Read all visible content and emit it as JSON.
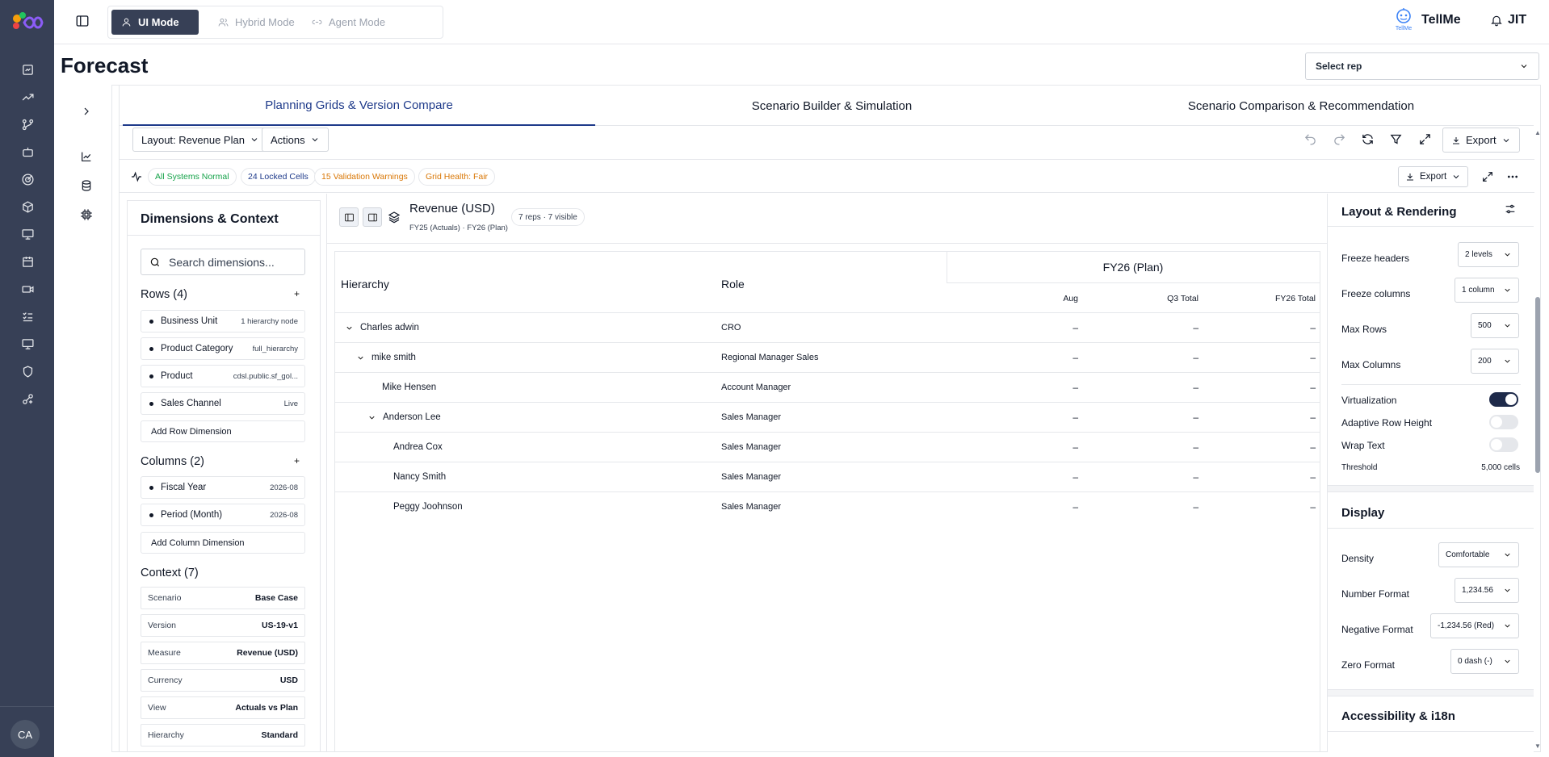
{
  "app": {
    "nav_icons": [
      "dashboard-icon",
      "trend-icon",
      "branch-icon",
      "bot-icon",
      "target-icon",
      "cube-icon",
      "monitor-icon",
      "calendar-icon",
      "video-icon",
      "checklist-icon",
      "display-icon",
      "shield-icon",
      "sparkle-icon"
    ],
    "avatar_initials": "CA",
    "brand_color": "#374056"
  },
  "topbar": {
    "modes": [
      {
        "label": "UI Mode",
        "icon": "user-icon",
        "active": true
      },
      {
        "label": "Hybrid Mode",
        "icon": "users-icon",
        "active": false
      },
      {
        "label": "Agent Mode",
        "icon": "link-icon",
        "active": false
      }
    ],
    "tellme_logo_text": "TellMe",
    "tellme_label": "TellMe",
    "jit_label": "JIT"
  },
  "page": {
    "title": "Forecast",
    "select_rep": "Select rep"
  },
  "tabs": [
    {
      "label": "Planning Grids & Version Compare",
      "active": true
    },
    {
      "label": "Scenario Builder & Simulation",
      "active": false
    },
    {
      "label": "Scenario Comparison & Recommendation",
      "active": false
    }
  ],
  "toolbar": {
    "layout_label": "Layout: Revenue Plan",
    "actions_label": "Actions",
    "export_label": "Export"
  },
  "status": {
    "pills": [
      {
        "label": "All Systems Normal",
        "color": "#16a34a"
      },
      {
        "label": "24 Locked Cells",
        "color": "#1e3a8a"
      },
      {
        "label": "15 Validation Warnings",
        "color": "#d97706"
      },
      {
        "label": "Grid Health: Fair",
        "color": "#d97706"
      }
    ],
    "export_label": "Export"
  },
  "dimensions": {
    "title": "Dimensions & Context",
    "search_placeholder": "Search dimensions...",
    "rows_title": "Rows (4)",
    "rows": [
      {
        "name": "Business Unit",
        "meta": "1 hierarchy node"
      },
      {
        "name": "Product Category",
        "meta": "full_hierarchy"
      },
      {
        "name": "Product",
        "meta": "cdsl.public.sf_gol..."
      },
      {
        "name": "Sales Channel",
        "meta": "Live"
      }
    ],
    "add_row_label": "Add Row Dimension",
    "columns_title": "Columns (2)",
    "columns": [
      {
        "name": "Fiscal Year",
        "meta": "2026-08"
      },
      {
        "name": "Period (Month)",
        "meta": "2026-08"
      }
    ],
    "add_column_label": "Add Column Dimension",
    "context_title": "Context (7)",
    "context": [
      {
        "key": "Scenario",
        "value": "Base Case"
      },
      {
        "key": "Version",
        "value": "US-19-v1"
      },
      {
        "key": "Measure",
        "value": "Revenue (USD)"
      },
      {
        "key": "Currency",
        "value": "USD"
      },
      {
        "key": "View",
        "value": "Actuals vs Plan"
      },
      {
        "key": "Hierarchy",
        "value": "Standard"
      }
    ]
  },
  "grid": {
    "title": "Revenue (USD)",
    "subtitle": "FY25 (Actuals) · FY26 (Plan)",
    "badge": "7 reps · 7 visible",
    "col_hierarchy": "Hierarchy",
    "col_role": "Role",
    "group_header": "FY26 (Plan)",
    "sub_columns": [
      "Aug",
      "Q3 Total",
      "FY26 Total"
    ],
    "rows": [
      {
        "name": "Charles adwin",
        "role": "CRO",
        "level": 0,
        "expandable": true,
        "values": [
          "–",
          "–",
          "–"
        ]
      },
      {
        "name": "mike smith",
        "role": "Regional Manager Sales",
        "level": 1,
        "expandable": true,
        "values": [
          "–",
          "–",
          "–"
        ]
      },
      {
        "name": "Mike Hensen",
        "role": "Account Manager",
        "level": 2,
        "expandable": false,
        "values": [
          "–",
          "–",
          "–"
        ]
      },
      {
        "name": "Anderson Lee",
        "role": "Sales Manager",
        "level": 2,
        "expandable": true,
        "values": [
          "–",
          "–",
          "–"
        ]
      },
      {
        "name": "Andrea Cox",
        "role": "Sales Manager",
        "level": 3,
        "expandable": false,
        "values": [
          "–",
          "–",
          "–"
        ]
      },
      {
        "name": "Nancy Smith",
        "role": "Sales Manager",
        "level": 3,
        "expandable": false,
        "values": [
          "–",
          "–",
          "–"
        ]
      },
      {
        "name": "Peggy Joohnson",
        "role": "Sales Manager",
        "level": 3,
        "expandable": false,
        "values": [
          "–",
          "–",
          "–"
        ]
      }
    ]
  },
  "layout_panel": {
    "title": "Layout & Rendering",
    "freeze_headers_label": "Freeze headers",
    "freeze_headers_value": "2 levels",
    "freeze_columns_label": "Freeze columns",
    "freeze_columns_value": "1 column",
    "max_rows_label": "Max Rows",
    "max_rows_value": "500",
    "max_columns_label": "Max Columns",
    "max_columns_value": "200",
    "virtualization_label": "Virtualization",
    "virtualization_on": true,
    "adaptive_label": "Adaptive Row Height",
    "adaptive_on": false,
    "wrap_label": "Wrap Text",
    "wrap_on": false,
    "threshold_label": "Threshold",
    "threshold_value": "5,000 cells"
  },
  "display_panel": {
    "title": "Display",
    "density_label": "Density",
    "density_value": "Comfortable",
    "number_format_label": "Number Format",
    "number_format_value": "1,234.56",
    "negative_format_label": "Negative Format",
    "negative_format_value": "-1,234.56 (Red)",
    "zero_format_label": "Zero Format",
    "zero_format_value": "0 dash (-)"
  },
  "accessibility_panel": {
    "title": "Accessibility & i18n"
  }
}
